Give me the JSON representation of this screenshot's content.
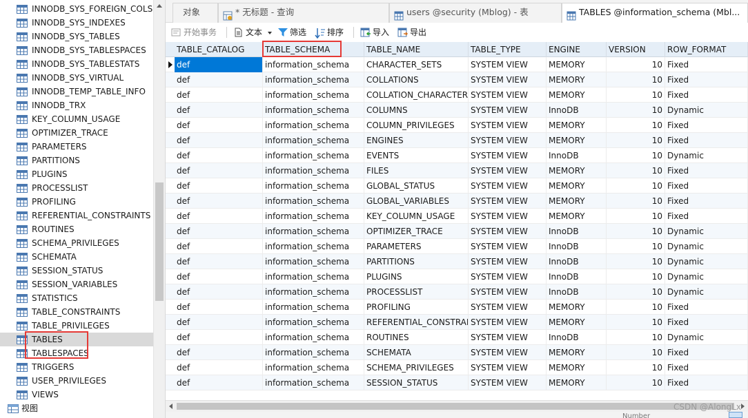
{
  "sidebar": {
    "items": [
      {
        "label": "INNODB_SYS_FOREIGN_COLS",
        "selected": false
      },
      {
        "label": "INNODB_SYS_INDEXES",
        "selected": false
      },
      {
        "label": "INNODB_SYS_TABLES",
        "selected": false
      },
      {
        "label": "INNODB_SYS_TABLESPACES",
        "selected": false
      },
      {
        "label": "INNODB_SYS_TABLESTATS",
        "selected": false
      },
      {
        "label": "INNODB_SYS_VIRTUAL",
        "selected": false
      },
      {
        "label": "INNODB_TEMP_TABLE_INFO",
        "selected": false
      },
      {
        "label": "INNODB_TRX",
        "selected": false
      },
      {
        "label": "KEY_COLUMN_USAGE",
        "selected": false
      },
      {
        "label": "OPTIMIZER_TRACE",
        "selected": false
      },
      {
        "label": "PARAMETERS",
        "selected": false
      },
      {
        "label": "PARTITIONS",
        "selected": false
      },
      {
        "label": "PLUGINS",
        "selected": false
      },
      {
        "label": "PROCESSLIST",
        "selected": false
      },
      {
        "label": "PROFILING",
        "selected": false
      },
      {
        "label": "REFERENTIAL_CONSTRAINTS",
        "selected": false
      },
      {
        "label": "ROUTINES",
        "selected": false
      },
      {
        "label": "SCHEMA_PRIVILEGES",
        "selected": false
      },
      {
        "label": "SCHEMATA",
        "selected": false
      },
      {
        "label": "SESSION_STATUS",
        "selected": false
      },
      {
        "label": "SESSION_VARIABLES",
        "selected": false
      },
      {
        "label": "STATISTICS",
        "selected": false
      },
      {
        "label": "TABLE_CONSTRAINTS",
        "selected": false
      },
      {
        "label": "TABLE_PRIVILEGES",
        "selected": false
      },
      {
        "label": "TABLES",
        "selected": true
      },
      {
        "label": "TABLESPACES",
        "selected": false
      },
      {
        "label": "TRIGGERS",
        "selected": false
      },
      {
        "label": "USER_PRIVILEGES",
        "selected": false
      },
      {
        "label": "VIEWS",
        "selected": false
      }
    ],
    "views_node_label": "视图"
  },
  "tabs": [
    {
      "label": "对象",
      "active": false
    },
    {
      "label": "* 无标题 - 查询",
      "active": false
    },
    {
      "label": "users @security (Mblog) - 表",
      "active": false
    },
    {
      "label": "TABLES @information_schema (Mbl...",
      "active": true
    }
  ],
  "toolbar": {
    "begin_transaction": "开始事务",
    "text": "文本",
    "filter": "筛选",
    "sort": "排序",
    "import": "导入",
    "export": "导出"
  },
  "grid": {
    "columns": [
      "TABLE_CATALOG",
      "TABLE_SCHEMA",
      "TABLE_NAME",
      "TABLE_TYPE",
      "ENGINE",
      "VERSION",
      "ROW_FORMAT"
    ],
    "rows": [
      [
        "def",
        "information_schema",
        "CHARACTER_SETS",
        "SYSTEM VIEW",
        "MEMORY",
        "10",
        "Fixed"
      ],
      [
        "def",
        "information_schema",
        "COLLATIONS",
        "SYSTEM VIEW",
        "MEMORY",
        "10",
        "Fixed"
      ],
      [
        "def",
        "information_schema",
        "COLLATION_CHARACTER_",
        "SYSTEM VIEW",
        "MEMORY",
        "10",
        "Fixed"
      ],
      [
        "def",
        "information_schema",
        "COLUMNS",
        "SYSTEM VIEW",
        "InnoDB",
        "10",
        "Dynamic"
      ],
      [
        "def",
        "information_schema",
        "COLUMN_PRIVILEGES",
        "SYSTEM VIEW",
        "MEMORY",
        "10",
        "Fixed"
      ],
      [
        "def",
        "information_schema",
        "ENGINES",
        "SYSTEM VIEW",
        "MEMORY",
        "10",
        "Fixed"
      ],
      [
        "def",
        "information_schema",
        "EVENTS",
        "SYSTEM VIEW",
        "InnoDB",
        "10",
        "Dynamic"
      ],
      [
        "def",
        "information_schema",
        "FILES",
        "SYSTEM VIEW",
        "MEMORY",
        "10",
        "Fixed"
      ],
      [
        "def",
        "information_schema",
        "GLOBAL_STATUS",
        "SYSTEM VIEW",
        "MEMORY",
        "10",
        "Fixed"
      ],
      [
        "def",
        "information_schema",
        "GLOBAL_VARIABLES",
        "SYSTEM VIEW",
        "MEMORY",
        "10",
        "Fixed"
      ],
      [
        "def",
        "information_schema",
        "KEY_COLUMN_USAGE",
        "SYSTEM VIEW",
        "MEMORY",
        "10",
        "Fixed"
      ],
      [
        "def",
        "information_schema",
        "OPTIMIZER_TRACE",
        "SYSTEM VIEW",
        "InnoDB",
        "10",
        "Dynamic"
      ],
      [
        "def",
        "information_schema",
        "PARAMETERS",
        "SYSTEM VIEW",
        "InnoDB",
        "10",
        "Dynamic"
      ],
      [
        "def",
        "information_schema",
        "PARTITIONS",
        "SYSTEM VIEW",
        "InnoDB",
        "10",
        "Dynamic"
      ],
      [
        "def",
        "information_schema",
        "PLUGINS",
        "SYSTEM VIEW",
        "InnoDB",
        "10",
        "Dynamic"
      ],
      [
        "def",
        "information_schema",
        "PROCESSLIST",
        "SYSTEM VIEW",
        "InnoDB",
        "10",
        "Dynamic"
      ],
      [
        "def",
        "information_schema",
        "PROFILING",
        "SYSTEM VIEW",
        "MEMORY",
        "10",
        "Fixed"
      ],
      [
        "def",
        "information_schema",
        "REFERENTIAL_CONSTRAII",
        "SYSTEM VIEW",
        "MEMORY",
        "10",
        "Fixed"
      ],
      [
        "def",
        "information_schema",
        "ROUTINES",
        "SYSTEM VIEW",
        "InnoDB",
        "10",
        "Dynamic"
      ],
      [
        "def",
        "information_schema",
        "SCHEMATA",
        "SYSTEM VIEW",
        "MEMORY",
        "10",
        "Fixed"
      ],
      [
        "def",
        "information_schema",
        "SCHEMA_PRIVILEGES",
        "SYSTEM VIEW",
        "MEMORY",
        "10",
        "Fixed"
      ],
      [
        "def",
        "information_schema",
        "SESSION_STATUS",
        "SYSTEM VIEW",
        "MEMORY",
        "10",
        "Fixed"
      ]
    ]
  },
  "watermark": "CSDN @AlongLx",
  "status_text": "Number",
  "colors": {
    "accent": "#0078d7",
    "highlight_box": "#e53935",
    "header_bg": "#e5eef7"
  }
}
